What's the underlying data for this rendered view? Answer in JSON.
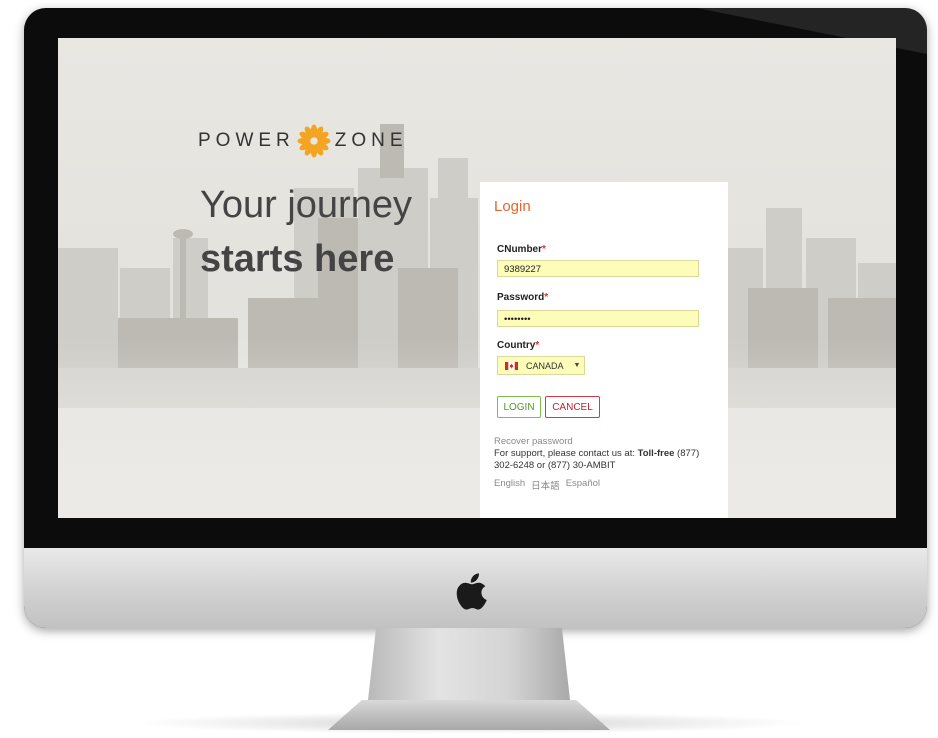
{
  "brand": {
    "word_left": "POWER",
    "word_right": "ZONE",
    "logo_color": "#f3a421"
  },
  "hero": {
    "line1": "Your journey",
    "line2": "starts here"
  },
  "login": {
    "title": "Login",
    "title_color": "#e8652b",
    "cnumber_label": "CNumber",
    "cnumber_value": "9389227",
    "password_label": "Password",
    "password_value": "••••••••",
    "country_label": "Country",
    "required_mark": "*",
    "country_selected": "CANADA",
    "login_button": "LOGIN",
    "cancel_button": "CANCEL",
    "field_bg": "#fdfdb9"
  },
  "footer": {
    "recover_link": "Recover password",
    "support_prefix": "For support, please contact us at: ",
    "support_bold": "Toll-free",
    "support_suffix": " (877) 302-6248 or (877) 30-AMBIT",
    "languages": [
      "English",
      "日本語",
      "Español"
    ]
  },
  "icons": {
    "brand_logo": "sun-flower-icon",
    "flag": "canada-flag-icon",
    "dropdown": "caret-down-icon",
    "device_logo": "apple-icon"
  }
}
